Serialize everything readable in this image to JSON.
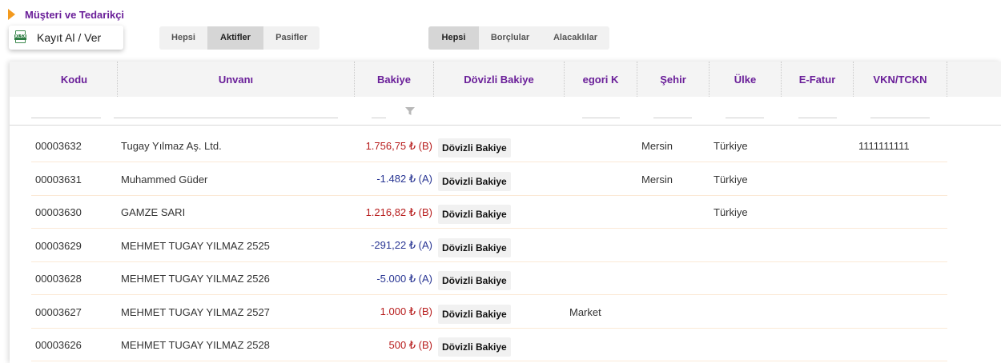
{
  "page": {
    "title": "Müşteri ve Tedarikçi"
  },
  "toolbar": {
    "export_label": "Kayıt Al / Ver",
    "export_icon": "excel-xlsx-icon"
  },
  "status_filter": {
    "options": [
      "Hepsi",
      "Aktifler",
      "Pasifler"
    ],
    "selected": "Aktifler"
  },
  "balance_filter": {
    "options": [
      "Hepsi",
      "Borçlular",
      "Alacaklılar"
    ],
    "selected": "Hepsi"
  },
  "columns": [
    "Kodu",
    "Unvanı",
    "Bakiye",
    "Dövizli Bakiye",
    "egori K",
    "Şehir",
    "Ülke",
    "E-Fatur",
    "VKN/TCKN"
  ],
  "fx_button_label": "Dövizli Bakiye",
  "colors": {
    "accent": "#6a1f99",
    "debt": "#b71c1c",
    "credit": "#283593",
    "marker": "#f39a1e"
  },
  "rows": [
    {
      "code": "00003632",
      "name": "Tugay Yılmaz Aş. Ltd.",
      "balance": "1.756,75 ₺ (B)",
      "type": "B",
      "category": "",
      "city": "Mersin",
      "country": "Türkiye",
      "efatura": "",
      "vkn": "1111111111"
    },
    {
      "code": "00003631",
      "name": "Muhammed Güder",
      "balance": "-1.482 ₺ (A)",
      "type": "A",
      "category": "",
      "city": "Mersin",
      "country": "Türkiye",
      "efatura": "",
      "vkn": ""
    },
    {
      "code": "00003630",
      "name": "GAMZE SARI",
      "balance": "1.216,82 ₺ (B)",
      "type": "B",
      "category": "",
      "city": "",
      "country": "Türkiye",
      "efatura": "",
      "vkn": ""
    },
    {
      "code": "00003629",
      "name": "MEHMET TUGAY YILMAZ 2525",
      "balance": "-291,22 ₺ (A)",
      "type": "A",
      "category": "",
      "city": "",
      "country": "",
      "efatura": "",
      "vkn": ""
    },
    {
      "code": "00003628",
      "name": "MEHMET TUGAY YILMAZ 2526",
      "balance": "-5.000 ₺ (A)",
      "type": "A",
      "category": "",
      "city": "",
      "country": "",
      "efatura": "",
      "vkn": ""
    },
    {
      "code": "00003627",
      "name": "MEHMET TUGAY YILMAZ 2527",
      "balance": "1.000 ₺ (B)",
      "type": "B",
      "category": "Market",
      "city": "",
      "country": "",
      "efatura": "",
      "vkn": ""
    },
    {
      "code": "00003626",
      "name": "MEHMET TUGAY YILMAZ 2528",
      "balance": "500 ₺ (B)",
      "type": "B",
      "category": "",
      "city": "",
      "country": "",
      "efatura": "",
      "vkn": ""
    }
  ]
}
